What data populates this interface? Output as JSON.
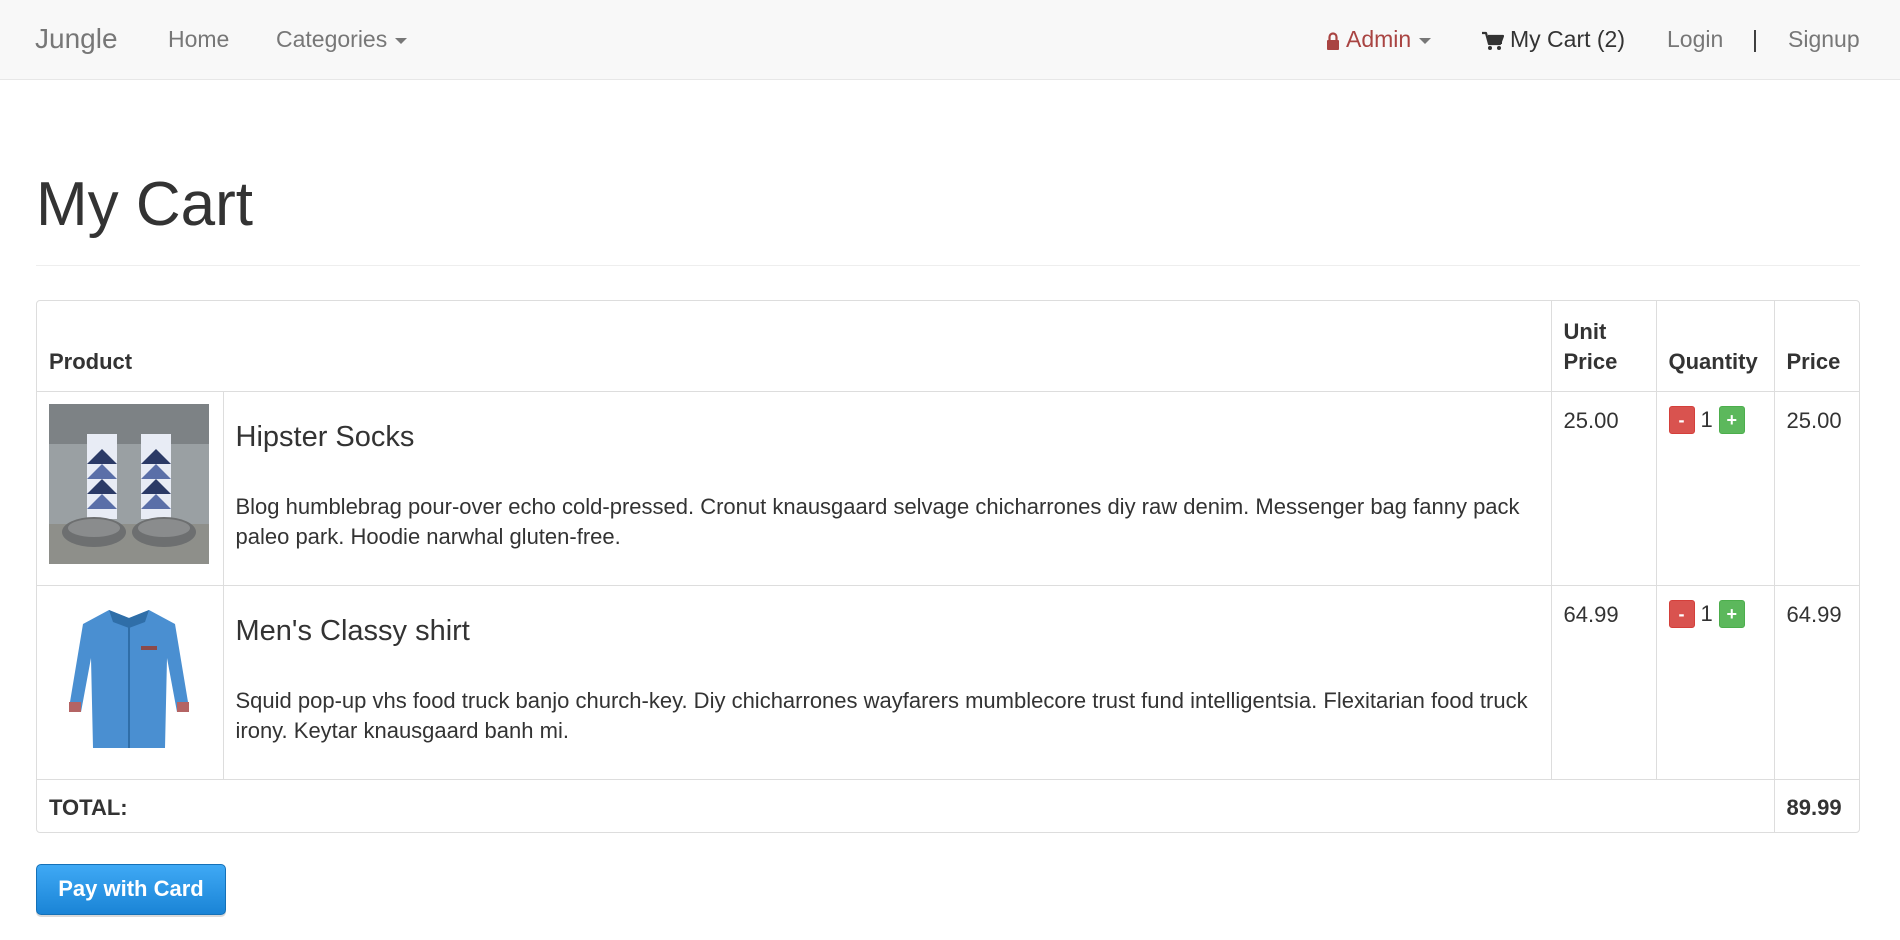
{
  "nav": {
    "brand": "Jungle",
    "home": "Home",
    "categories": "Categories",
    "admin": "Admin",
    "cart": "My Cart (2)",
    "login": "Login",
    "separator": "|",
    "signup": "Signup"
  },
  "page": {
    "title": "My Cart"
  },
  "table": {
    "headers": {
      "product": "Product",
      "unit_price_1": "Unit",
      "unit_price_2": "Price",
      "quantity": "Quantity",
      "price": "Price"
    },
    "items": [
      {
        "name": "Hipster Socks",
        "description": "Blog humblebrag pour-over echo cold-pressed. Cronut knausgaard selvage chicharrones diy raw denim. Messenger bag fanny pack paleo park. Hoodie narwhal gluten-free.",
        "unit_price": "25.00",
        "quantity": "1",
        "price": "25.00",
        "image": "socks-product-image"
      },
      {
        "name": "Men's Classy shirt",
        "description": "Squid pop-up vhs food truck banjo church-key. Diy chicharrones wayfarers mumblecore trust fund intelligentsia. Flexitarian food truck irony. Keytar knausgaard banh mi.",
        "unit_price": "64.99",
        "quantity": "1",
        "price": "64.99",
        "image": "shirt-product-image"
      }
    ],
    "minus_label": "-",
    "plus_label": "+",
    "total_label": "TOTAL:",
    "total_value": "89.99"
  },
  "pay_button": "Pay with Card",
  "colors": {
    "admin": "#a94442",
    "minus": "#d9534f",
    "plus": "#5cb85c",
    "pay": "#2a95e6"
  }
}
